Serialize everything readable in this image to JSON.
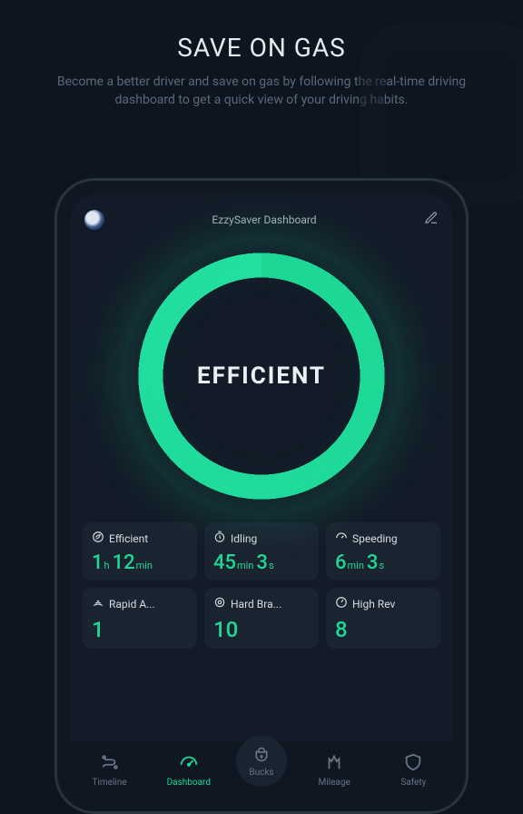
{
  "promo": {
    "headline": "SAVE ON GAS",
    "subhead": "Become a better driver and save on gas by following the real-time driving dashboard to get a quick view of your driving habits."
  },
  "app": {
    "title": "EzzySaver Dashboard"
  },
  "ring": {
    "label": "EFFICIENT",
    "accent_color": "#1ed795"
  },
  "metrics": [
    {
      "icon": "leaf",
      "label": "Efficient",
      "value_parts": [
        {
          "n": "1",
          "u": "h"
        },
        {
          "n": "12",
          "u": "min"
        }
      ]
    },
    {
      "icon": "timer",
      "label": "Idling",
      "value_parts": [
        {
          "n": "45",
          "u": "min"
        },
        {
          "n": "3",
          "u": "s"
        }
      ]
    },
    {
      "icon": "gauge",
      "label": "Speeding",
      "value_parts": [
        {
          "n": "6",
          "u": "min"
        },
        {
          "n": "3",
          "u": "s"
        }
      ]
    },
    {
      "icon": "signal",
      "label": "Rapid A...",
      "single": "1"
    },
    {
      "icon": "target",
      "label": "Hard Bra...",
      "single": "10"
    },
    {
      "icon": "tach",
      "label": "High Rev",
      "single": "8"
    }
  ],
  "nav": {
    "items": [
      {
        "icon": "route",
        "label": "Timeline",
        "active": false
      },
      {
        "icon": "gauge",
        "label": "Dashboard",
        "active": true
      },
      {
        "icon": "bucks",
        "label": "Bucks",
        "center": true
      },
      {
        "icon": "mileage",
        "label": "Mileage",
        "active": false
      },
      {
        "icon": "shield",
        "label": "Safety",
        "active": false
      }
    ]
  }
}
